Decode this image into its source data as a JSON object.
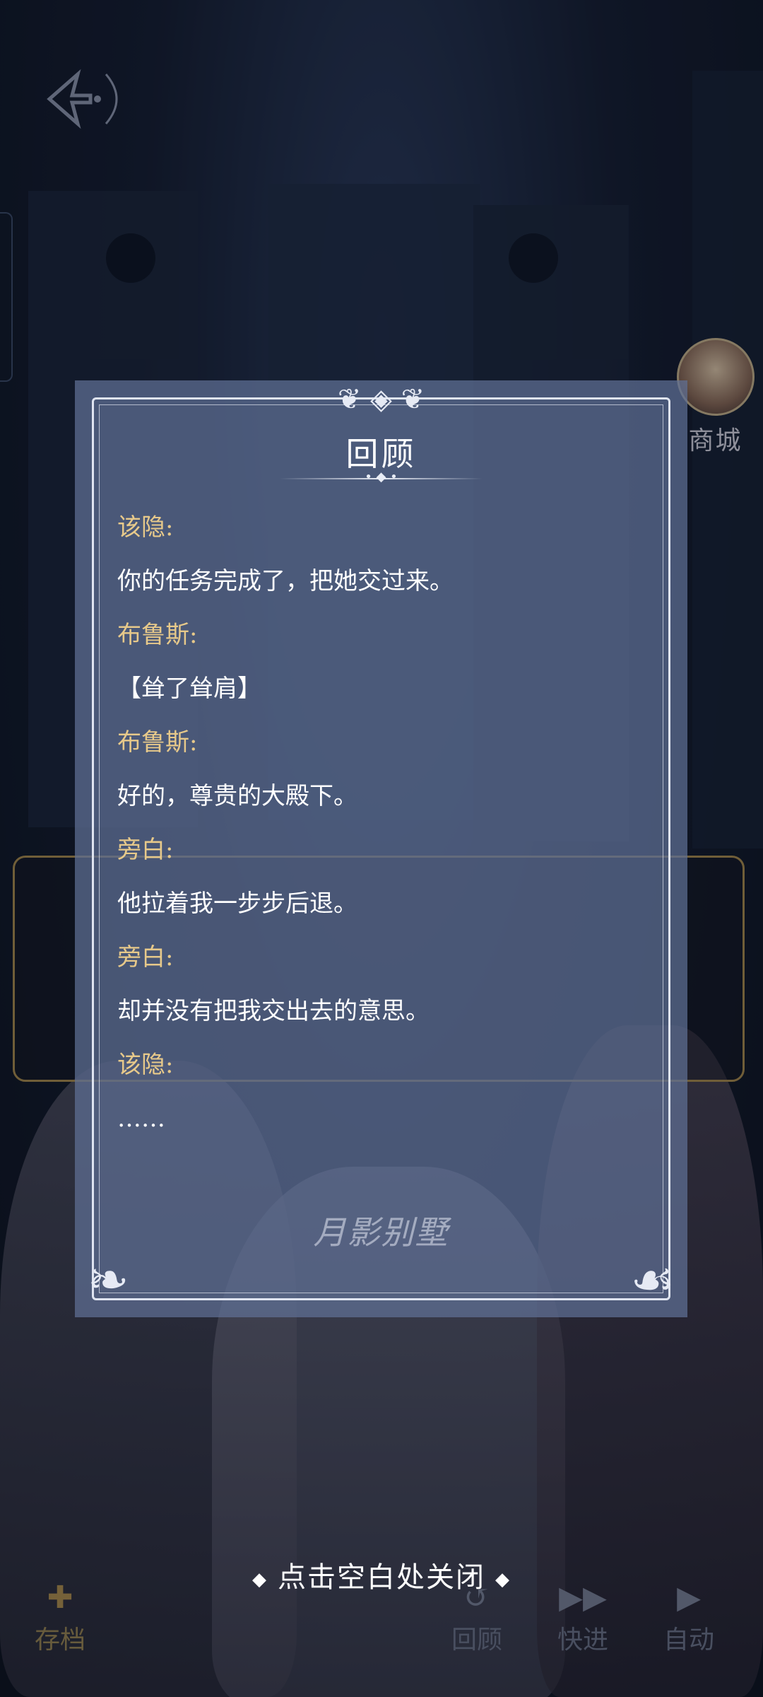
{
  "panel": {
    "title": "回顾",
    "watermark": "月影别墅",
    "entries": [
      {
        "speaker": "该隐:",
        "text": "你的任务完成了，把她交过来。"
      },
      {
        "speaker": "布鲁斯:",
        "text": "【耸了耸肩】"
      },
      {
        "speaker": "布鲁斯:",
        "text": "好的，尊贵的大殿下。"
      },
      {
        "speaker": "旁白:",
        "text": "他拉着我一步步后退。"
      },
      {
        "speaker": "旁白:",
        "text": "却并没有把我交出去的意思。"
      },
      {
        "speaker": "该隐:",
        "text": "……"
      }
    ]
  },
  "shop": {
    "label": "商城"
  },
  "toolbar": {
    "save": "存档",
    "review": "回顾",
    "fast_forward": "快进",
    "auto": "自动"
  },
  "close_hint": "点击空白处关闭",
  "icons": {
    "back": "back-arrow-icon",
    "fast_forward": "fast-forward-icon",
    "auto": "play-icon",
    "review": "history-icon",
    "save": "save-icon"
  },
  "colors": {
    "speaker": "#e7c98a",
    "text": "#ffffff",
    "panel_bg": "#6070a0"
  }
}
